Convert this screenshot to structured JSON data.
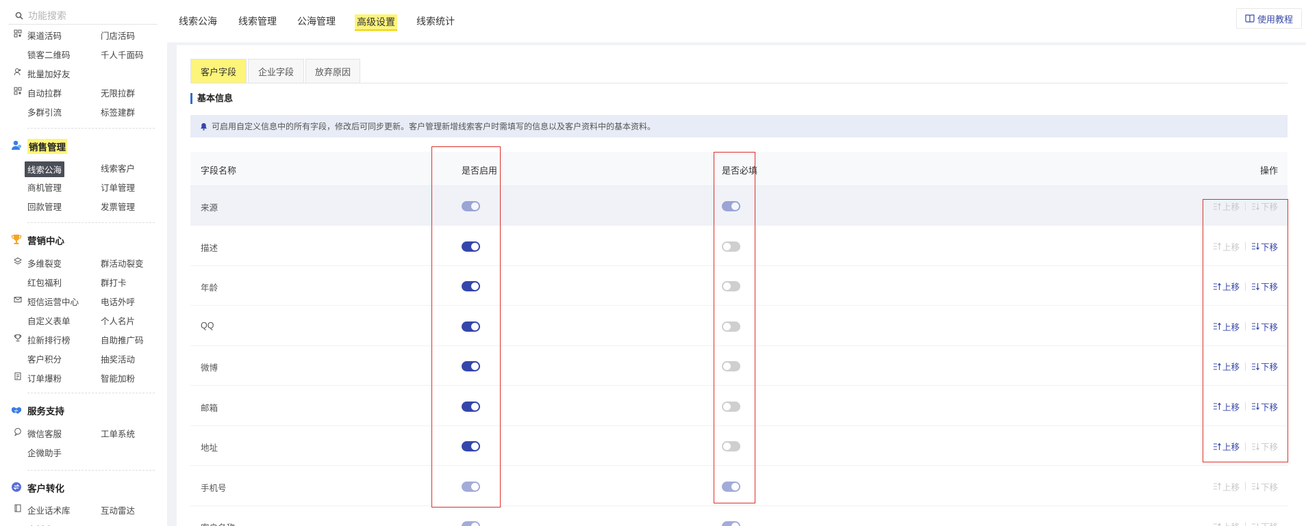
{
  "sidebar": {
    "search_placeholder": "功能搜索",
    "rows": [
      {
        "icon": "qrcode-icon",
        "c1": "渠道活码",
        "c2": "门店活码"
      },
      {
        "icon": "",
        "c1": "锁客二维码",
        "c2": "千人千面码"
      },
      {
        "icon": "add-friend-icon",
        "c1": "批量加好友",
        "c2": ""
      },
      {
        "icon": "qrcode-icon",
        "c1": "自动拉群",
        "c2": "无限拉群"
      },
      {
        "icon": "",
        "c1": "多群引流",
        "c2": "标签建群"
      },
      {
        "icon": "",
        "c1": "线索公海",
        "c2": "线索客户"
      },
      {
        "icon": "",
        "c1": "商机管理",
        "c2": "订单管理"
      },
      {
        "icon": "",
        "c1": "回款管理",
        "c2": "发票管理"
      },
      {
        "icon": "fission-icon",
        "c1": "多维裂变",
        "c2": "群活动裂变"
      },
      {
        "icon": "",
        "c1": "红包福利",
        "c2": "群打卡"
      },
      {
        "icon": "mail-icon",
        "c1": "短信运营中心",
        "c2": "电话外呼"
      },
      {
        "icon": "",
        "c1": "自定义表单",
        "c2": "个人名片"
      },
      {
        "icon": "trophy-icon",
        "c1": "拉新排行榜",
        "c2": "自助推广码"
      },
      {
        "icon": "",
        "c1": "客户积分",
        "c2": "抽奖活动"
      },
      {
        "icon": "order-icon",
        "c1": "订单爆粉",
        "c2": "智能加粉"
      },
      {
        "icon": "chat-icon",
        "c1": "微信客服",
        "c2": "工单系统"
      },
      {
        "icon": "",
        "c1": "企微助手",
        "c2": ""
      },
      {
        "icon": "book-icon",
        "c1": "企业话术库",
        "c2": "互动雷达"
      },
      {
        "icon": "",
        "c1": "素材库",
        "c2": ""
      }
    ],
    "sections": [
      {
        "icon": "sales-icon",
        "title": "销售管理"
      },
      {
        "icon": "marketing-trophy-icon",
        "title": "营销中心"
      },
      {
        "icon": "handshake-icon",
        "title": "服务支持"
      },
      {
        "icon": "conversion-icon",
        "title": "客户转化"
      }
    ]
  },
  "topnav": {
    "tabs": [
      "线索公海",
      "线索管理",
      "公海管理",
      "高级设置",
      "线索统计"
    ],
    "active_tab": "高级设置",
    "help_label": "使用教程"
  },
  "subtabs": [
    "客户字段",
    "企业字段",
    "放弃原因"
  ],
  "section_title": "基本信息",
  "notice": "可启用自定义信息中的所有字段，修改后可同步更新。客户管理新增线索客户时需填写的信息以及客户资料中的基本资料。",
  "table": {
    "headers": {
      "name": "字段名称",
      "enabled": "是否启用",
      "required": "是否必填",
      "ops": "操作"
    },
    "up_label": "上移",
    "down_label": "下移",
    "rows": [
      {
        "name": "来源",
        "enabled": true,
        "enabled_disabled": true,
        "required": true,
        "required_disabled": true,
        "up_enabled": false,
        "down_enabled": false
      },
      {
        "name": "描述",
        "enabled": true,
        "enabled_disabled": false,
        "required": false,
        "required_disabled": false,
        "up_enabled": false,
        "down_enabled": true
      },
      {
        "name": "年龄",
        "enabled": true,
        "enabled_disabled": false,
        "required": false,
        "required_disabled": false,
        "up_enabled": true,
        "down_enabled": true
      },
      {
        "name": "QQ",
        "enabled": true,
        "enabled_disabled": false,
        "required": false,
        "required_disabled": false,
        "up_enabled": true,
        "down_enabled": true
      },
      {
        "name": "微博",
        "enabled": true,
        "enabled_disabled": false,
        "required": false,
        "required_disabled": false,
        "up_enabled": true,
        "down_enabled": true
      },
      {
        "name": "邮箱",
        "enabled": true,
        "enabled_disabled": false,
        "required": false,
        "required_disabled": false,
        "up_enabled": true,
        "down_enabled": true
      },
      {
        "name": "地址",
        "enabled": true,
        "enabled_disabled": false,
        "required": false,
        "required_disabled": false,
        "up_enabled": true,
        "down_enabled": false
      },
      {
        "name": "手机号",
        "enabled": true,
        "enabled_disabled": true,
        "required": true,
        "required_disabled": true,
        "up_enabled": false,
        "down_enabled": false
      },
      {
        "name": "客户名称",
        "enabled": true,
        "enabled_disabled": true,
        "required": true,
        "required_disabled": true,
        "up_enabled": false,
        "down_enabled": false
      }
    ]
  },
  "colors": {
    "accent": "#3546ab",
    "highlight": "#fdf47a",
    "annotation_red": "#d9312b"
  }
}
